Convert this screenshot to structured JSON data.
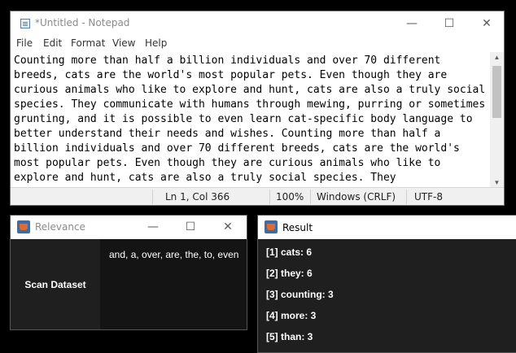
{
  "notepad": {
    "title": "*Untitled - Notepad",
    "menu": [
      "File",
      "Edit",
      "Format",
      "View",
      "Help"
    ],
    "text": "Counting more than half a billion individuals and over 70 different breeds, cats are the world's most popular pets. Even though they are curious animals who like to explore and hunt, cats are also a truly social species. They communicate with humans through mewing, purring or sometimes grunting, and it is possible to even learn cat-specific body language to better understand their needs and wishes. Counting more than half a billion individuals and over 70 different breeds, cats are the world's most popular pets. Even though they are curious animals who like to explore and hunt, cats are also a truly social species. They",
    "status": {
      "position": "Ln 1, Col 366",
      "zoom": "100%",
      "line_ending": "Windows (CRLF)",
      "encoding": "UTF-8"
    },
    "window_controls": {
      "minimize": "—",
      "maximize": "☐",
      "close": "✕"
    }
  },
  "relevance": {
    "title": "Relevance",
    "scan_button": "Scan Dataset",
    "stop_words": "and, a, over, are, the, to, even",
    "window_controls": {
      "minimize": "—",
      "maximize": "☐",
      "close": "✕"
    }
  },
  "result": {
    "title": "Result",
    "items": [
      "[1] cats: 6",
      "[2] they: 6",
      "[3] counting: 3",
      "[4] more: 3",
      "[5] than: 3"
    ]
  },
  "colors": {
    "dark_panel": "#1f1f1f",
    "dark_text_area": "#141414",
    "background": "#000000"
  }
}
